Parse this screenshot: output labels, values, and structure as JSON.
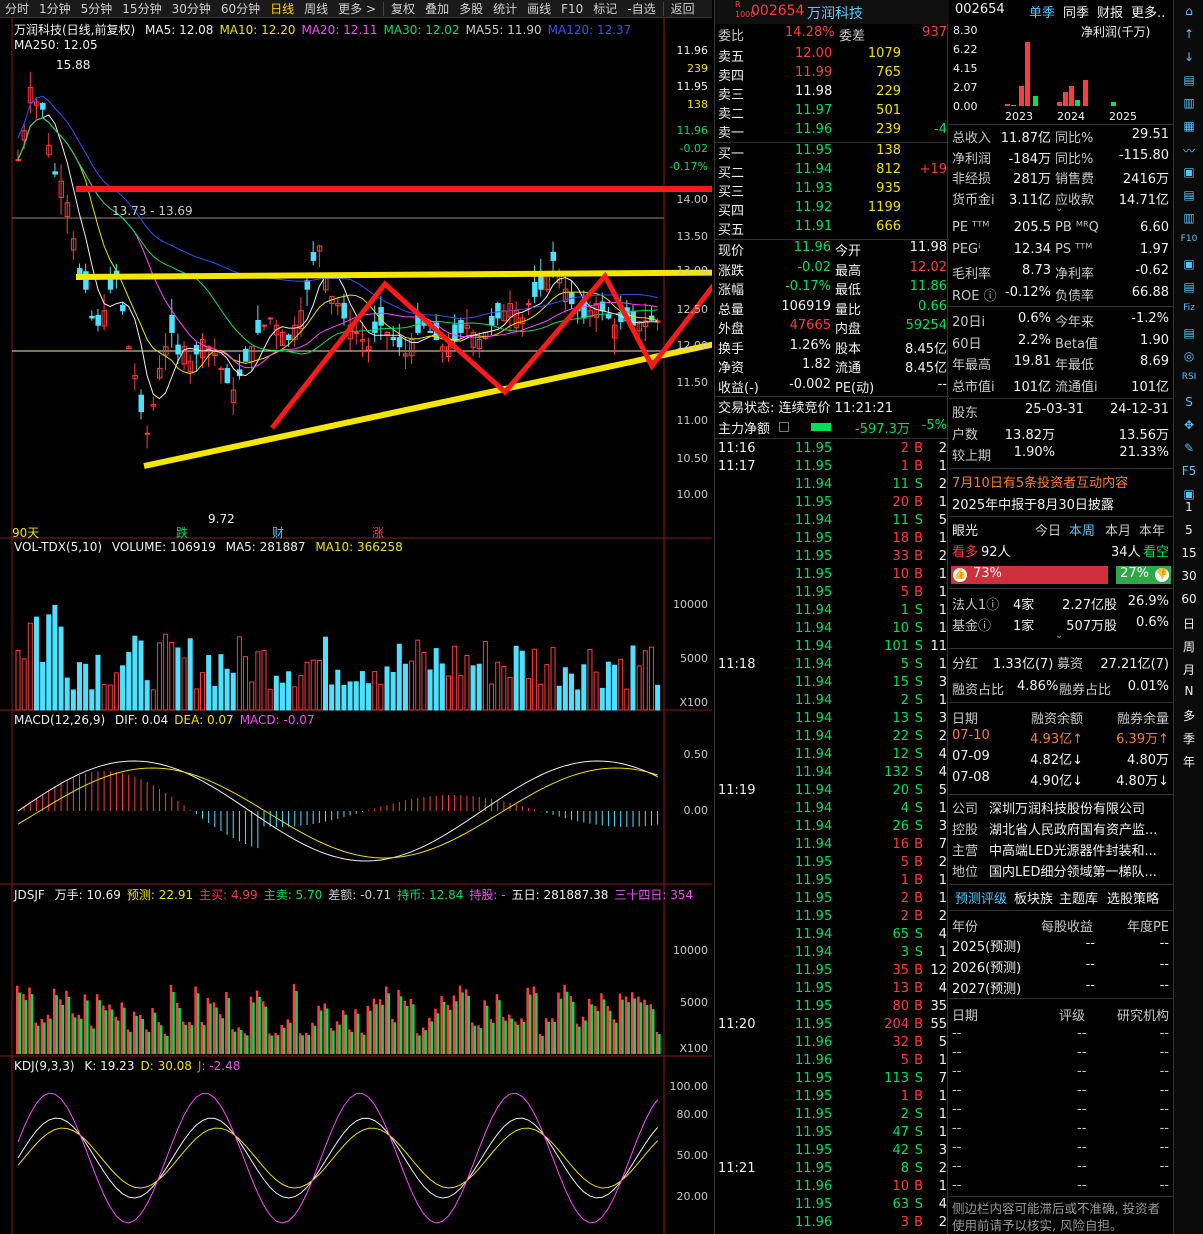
{
  "toolbar": {
    "items": [
      "分时",
      "1分钟",
      "5分钟",
      "15分钟",
      "30分钟",
      "60分钟",
      "日线",
      "周线",
      "更多 >",
      "复权",
      "叠加",
      "多股",
      "统计",
      "画线",
      "F10",
      "标记",
      "-自选",
      "返回"
    ],
    "active": "日线"
  },
  "main_chart": {
    "title": "万润科技(日线,前复权)",
    "ma_labels": [
      {
        "text": "MA5: 12.08",
        "color": "#f0f0f0"
      },
      {
        "text": "MA10: 12.20",
        "color": "#f0e000"
      },
      {
        "text": "MA20: 12.11",
        "color": "#ff44ff"
      },
      {
        "text": "MA30: 12.02",
        "color": "#00e05a"
      },
      {
        "text": "MA55: 11.90",
        "color": "#c8c8c8"
      },
      {
        "text": "MA120: 12.37",
        "color": "#3050ff"
      }
    ],
    "ma250": "MA250: 12.05",
    "high_label": "15.88",
    "low_label": "9.72",
    "range_label": "13.73 - 13.69",
    "period_label": "90天",
    "markers": [
      {
        "text": "跌",
        "color": "#00e05a"
      },
      {
        "text": "财",
        "color": "#4fc7ff"
      },
      {
        "text": "涨",
        "color": "#ff3b3b"
      }
    ],
    "price_axis": [
      "11.96",
      "239",
      "11.95",
      "138",
      "11.96",
      "-0.02",
      "-0.17%",
      "14.00",
      "13.50",
      "13.00",
      "12.50",
      "12.00",
      "11.50",
      "11.00",
      "10.50",
      "10.00"
    ]
  },
  "volume_panel": {
    "title": "VOL-TDX(5,10)",
    "values": [
      "VOLUME: 106919",
      "MA5: 281887",
      "MA10: 366258"
    ],
    "axis": [
      "10000",
      "5000",
      "X100"
    ]
  },
  "macd_panel": {
    "title": "MACD(12,26,9)",
    "values": [
      {
        "text": "DIF: 0.04",
        "color": "#f0f0f0"
      },
      {
        "text": "DEA: 0.07",
        "color": "#f0e000"
      },
      {
        "text": "MACD: -0.07",
        "color": "#ff44ff"
      }
    ],
    "axis": [
      "0.50",
      "0.00"
    ]
  },
  "jdsjf_panel": {
    "title": "JDSJF",
    "values": [
      {
        "text": "万手: 10.69",
        "color": "#f0f0f0"
      },
      {
        "text": "预测: 22.91",
        "color": "#f0e000"
      },
      {
        "text": "主买: 4.99",
        "color": "#ff3b3b"
      },
      {
        "text": "主卖: 5.70",
        "color": "#00e05a"
      },
      {
        "text": "差额: -0.71",
        "color": "#c8c8c8"
      },
      {
        "text": "持币: 12.84",
        "color": "#00e05a"
      },
      {
        "text": "持股: -",
        "color": "#ff44ff"
      },
      {
        "text": "五日: 281887.38",
        "color": "#f0f0f0"
      },
      {
        "text": "三十四日: 354",
        "color": "#ff44ff"
      }
    ],
    "axis": [
      "10000",
      "5000",
      "X100"
    ]
  },
  "kdj_panel": {
    "title": "KDJ(9,3,3)",
    "values": [
      {
        "text": "K: 19.23",
        "color": "#f0f0f0"
      },
      {
        "text": "D: 30.08",
        "color": "#f0e000"
      },
      {
        "text": "J: -2.48",
        "color": "#ff44ff"
      }
    ],
    "axis": [
      "100.00",
      "80.00",
      "50.00",
      "20.00"
    ]
  },
  "quote": {
    "code": "002654",
    "name": "万润科技",
    "weibi_label": "委比",
    "weibi": "14.28%",
    "weicha_label": "委差",
    "weicha": "937",
    "asks": [
      {
        "label": "卖五",
        "price": "12.00",
        "vol": "1079",
        "pc": "#ff3b3b"
      },
      {
        "label": "卖四",
        "price": "11.99",
        "vol": "765",
        "pc": "#ff3b3b"
      },
      {
        "label": "卖三",
        "price": "11.98",
        "vol": "229",
        "pc": "#f0f0f0"
      },
      {
        "label": "卖二",
        "price": "11.97",
        "vol": "501",
        "pc": "#00e05a"
      },
      {
        "label": "卖一",
        "price": "11.96",
        "vol": "239",
        "pc": "#00e05a",
        "chg": "-4"
      }
    ],
    "bids": [
      {
        "label": "买一",
        "price": "11.95",
        "vol": "138",
        "pc": "#00e05a"
      },
      {
        "label": "买二",
        "price": "11.94",
        "vol": "812",
        "pc": "#00e05a",
        "chg": "+19"
      },
      {
        "label": "买三",
        "price": "11.93",
        "vol": "935",
        "pc": "#00e05a"
      },
      {
        "label": "买四",
        "price": "11.92",
        "vol": "1199",
        "pc": "#00e05a"
      },
      {
        "label": "买五",
        "price": "11.91",
        "vol": "666",
        "pc": "#00e05a"
      }
    ],
    "stats": [
      {
        "l1": "现价",
        "v1": "11.96",
        "c1": "#00e05a",
        "l2": "今开",
        "v2": "11.98",
        "c2": "#f0f0f0"
      },
      {
        "l1": "涨跌",
        "v1": "-0.02",
        "c1": "#00e05a",
        "l2": "最高",
        "v2": "12.02",
        "c2": "#ff3b3b"
      },
      {
        "l1": "涨幅",
        "v1": "-0.17%",
        "c1": "#00e05a",
        "l2": "最低",
        "v2": "11.86",
        "c2": "#00e05a"
      },
      {
        "l1": "总量",
        "v1": "106919",
        "c1": "#f0f0f0",
        "l2": "量比",
        "v2": "0.66",
        "c2": "#00e05a"
      },
      {
        "l1": "外盘",
        "v1": "47665",
        "c1": "#ff3b3b",
        "l2": "内盘",
        "v2": "59254",
        "c2": "#00e05a"
      },
      {
        "l1": "换手",
        "v1": "1.26%",
        "c1": "#f0f0f0",
        "l2": "股本",
        "v2": "8.45亿",
        "c2": "#f0f0f0"
      },
      {
        "l1": "净资",
        "v1": "1.82",
        "c1": "#f0f0f0",
        "l2": "流通",
        "v2": "8.45亿",
        "c2": "#f0f0f0"
      },
      {
        "l1": "收益(-)",
        "v1": "-0.002",
        "c1": "#f0f0f0",
        "l2": "PE(动)",
        "v2": "--",
        "c2": "#f0f0f0"
      }
    ],
    "status": "交易状态: 连续竞价 11:21:21",
    "main_flow_label": "主力净额",
    "main_flow": "-597.3万",
    "main_flow_pct": "-5%",
    "ticks": [
      {
        "t": "11:16",
        "p": "11.95",
        "v": "2",
        "d": "B",
        "n": "2"
      },
      {
        "t": "11:17",
        "p": "11.95",
        "v": "1",
        "d": "B",
        "n": "1"
      },
      {
        "t": "",
        "p": "11.94",
        "v": "11",
        "d": "S",
        "n": "2"
      },
      {
        "t": "",
        "p": "11.95",
        "v": "20",
        "d": "B",
        "n": "1"
      },
      {
        "t": "",
        "p": "11.94",
        "v": "11",
        "d": "S",
        "n": "5"
      },
      {
        "t": "",
        "p": "11.95",
        "v": "18",
        "d": "B",
        "n": "1"
      },
      {
        "t": "",
        "p": "11.95",
        "v": "33",
        "d": "B",
        "n": "2"
      },
      {
        "t": "",
        "p": "11.95",
        "v": "10",
        "d": "B",
        "n": "1"
      },
      {
        "t": "",
        "p": "11.95",
        "v": "5",
        "d": "B",
        "n": "1"
      },
      {
        "t": "",
        "p": "11.94",
        "v": "1",
        "d": "S",
        "n": "1"
      },
      {
        "t": "",
        "p": "11.94",
        "v": "10",
        "d": "S",
        "n": "1"
      },
      {
        "t": "",
        "p": "11.94",
        "v": "101",
        "d": "S",
        "n": "11"
      },
      {
        "t": "11:18",
        "p": "11.94",
        "v": "5",
        "d": "S",
        "n": "1"
      },
      {
        "t": "",
        "p": "11.94",
        "v": "15",
        "d": "S",
        "n": "3"
      },
      {
        "t": "",
        "p": "11.94",
        "v": "2",
        "d": "S",
        "n": "1"
      },
      {
        "t": "",
        "p": "11.94",
        "v": "13",
        "d": "S",
        "n": "3"
      },
      {
        "t": "",
        "p": "11.94",
        "v": "22",
        "d": "S",
        "n": "2"
      },
      {
        "t": "",
        "p": "11.94",
        "v": "12",
        "d": "S",
        "n": "4"
      },
      {
        "t": "",
        "p": "11.94",
        "v": "132",
        "d": "S",
        "n": "4"
      },
      {
        "t": "11:19",
        "p": "11.94",
        "v": "20",
        "d": "S",
        "n": "5"
      },
      {
        "t": "",
        "p": "11.94",
        "v": "4",
        "d": "S",
        "n": "1"
      },
      {
        "t": "",
        "p": "11.94",
        "v": "26",
        "d": "S",
        "n": "3"
      },
      {
        "t": "",
        "p": "11.94",
        "v": "16",
        "d": "B",
        "n": "7"
      },
      {
        "t": "",
        "p": "11.95",
        "v": "5",
        "d": "B",
        "n": "2"
      },
      {
        "t": "",
        "p": "11.95",
        "v": "1",
        "d": "B",
        "n": "1"
      },
      {
        "t": "",
        "p": "11.95",
        "v": "2",
        "d": "B",
        "n": "1"
      },
      {
        "t": "",
        "p": "11.95",
        "v": "2",
        "d": "B",
        "n": "2"
      },
      {
        "t": "",
        "p": "11.94",
        "v": "65",
        "d": "S",
        "n": "4"
      },
      {
        "t": "",
        "p": "11.94",
        "v": "3",
        "d": "S",
        "n": "1"
      },
      {
        "t": "",
        "p": "11.95",
        "v": "35",
        "d": "B",
        "n": "12"
      },
      {
        "t": "",
        "p": "11.95",
        "v": "13",
        "d": "B",
        "n": "4"
      },
      {
        "t": "",
        "p": "11.95",
        "v": "80",
        "d": "B",
        "n": "35"
      },
      {
        "t": "11:20",
        "p": "11.95",
        "v": "204",
        "d": "B",
        "n": "55"
      },
      {
        "t": "",
        "p": "11.96",
        "v": "32",
        "d": "B",
        "n": "5"
      },
      {
        "t": "",
        "p": "11.96",
        "v": "5",
        "d": "B",
        "n": "1"
      },
      {
        "t": "",
        "p": "11.95",
        "v": "113",
        "d": "S",
        "n": "7"
      },
      {
        "t": "",
        "p": "11.95",
        "v": "1",
        "d": "B",
        "n": "1"
      },
      {
        "t": "",
        "p": "11.95",
        "v": "2",
        "d": "S",
        "n": "1"
      },
      {
        "t": "",
        "p": "11.95",
        "v": "47",
        "d": "S",
        "n": "1"
      },
      {
        "t": "",
        "p": "11.95",
        "v": "42",
        "d": "S",
        "n": "3"
      },
      {
        "t": "11:21",
        "p": "11.95",
        "v": "8",
        "d": "S",
        "n": "2"
      },
      {
        "t": "",
        "p": "11.96",
        "v": "10",
        "d": "B",
        "n": "1"
      },
      {
        "t": "",
        "p": "11.95",
        "v": "63",
        "d": "S",
        "n": "4"
      },
      {
        "t": "",
        "p": "11.96",
        "v": "3",
        "d": "B",
        "n": "2"
      }
    ]
  },
  "info": {
    "code": "002654",
    "tabs": [
      "单季",
      "同季",
      "财报",
      "更多.."
    ],
    "chart_title": "净利润(千万)",
    "chart_axis": [
      "8.30",
      "6.22",
      "4.15",
      "2.07",
      "0.00"
    ],
    "chart_years": [
      "2023",
      "2024",
      "2025"
    ],
    "fin": [
      {
        "l1": "总收入",
        "v1": "11.87亿",
        "l2": "同比%",
        "v2": "29.51"
      },
      {
        "l1": "净利润",
        "v1": "-184万",
        "l2": "同比%",
        "v2": "-115.80"
      },
      {
        "l1": "非经损",
        "v1": "281万",
        "l2": "销售费",
        "v2": "2416万"
      },
      {
        "l1": "货币金i",
        "v1": "3.11亿",
        "l2": "应收款",
        "v2": "14.71亿"
      }
    ],
    "val": [
      {
        "l1": "PE ᵀᵀᴹ",
        "v1": "205.5",
        "l2": "PB ᴹᴿQ",
        "v2": "6.60"
      },
      {
        "l1": "PEGⁱ",
        "v1": "12.34",
        "l2": "PS ᵀᵀᴹ",
        "v2": "1.97"
      },
      {
        "l1": "毛利率",
        "v1": "8.73",
        "l2": "净利率",
        "v2": "-0.62"
      },
      {
        "l1": "ROE ⓘ",
        "v1": "-0.12%",
        "l2": "负债率",
        "v2": "66.88"
      }
    ],
    "perf": [
      {
        "l1": "20日i",
        "v1": "0.6%",
        "l2": "今年来",
        "v2": "-1.2%"
      },
      {
        "l1": "60日",
        "v1": "2.2%",
        "l2": "Beta值",
        "v2": "1.90"
      },
      {
        "l1": "年最高",
        "v1": "19.81",
        "l2": "年最低",
        "v2": "8.69"
      },
      {
        "l1": "总市值i",
        "v1": "101亿",
        "l2": "流通值i",
        "v2": "101亿"
      }
    ],
    "holders_hdr": {
      "l": "股东",
      "d1": "25-03-31",
      "d2": "24-12-31"
    },
    "holders": [
      {
        "l": "户数",
        "v1": "13.82万",
        "v2": "13.56万"
      },
      {
        "l": "较上期",
        "v1": "1.90%",
        "v2": "21.33%"
      }
    ],
    "notice1": "7月10日有5条投资者互动内容",
    "notice2": "2025年中报于8月30日披露",
    "eye_label": "眼光",
    "eye_tabs": [
      "今日",
      "本周",
      "本月",
      "本年"
    ],
    "bull_label": "看多",
    "bull_count": "92人",
    "bear_count": "34人",
    "bear_label": "看空",
    "bull_pct": "73%",
    "bear_pct": "27%",
    "inst": [
      {
        "l": "法人1ⓘ",
        "n": "4家",
        "v": "2.27亿股",
        "p": "26.9%"
      },
      {
        "l": "基金ⓘ",
        "n": "1家",
        "v": "507万股",
        "p": "0.6%"
      }
    ],
    "fenhong": {
      "l1": "分红",
      "v1": "1.33亿(7)",
      "l2": "募资",
      "v2": "27.21亿(7)"
    },
    "margin": {
      "l1": "融资占比",
      "v1": "4.86%",
      "l2": "融券占比",
      "v2": "0.01%"
    },
    "margin_hdr": [
      "日期",
      "融资余额",
      "融券余量"
    ],
    "margin_rows": [
      {
        "d": "07-10",
        "a": "4.93亿↑",
        "b": "6.39万↑",
        "hl": true
      },
      {
        "d": "07-09",
        "a": "4.82亿↓",
        "b": "4.80万",
        "hl": false
      },
      {
        "d": "07-08",
        "a": "4.90亿↓",
        "b": "4.80万↓",
        "hl": false
      }
    ],
    "company": [
      {
        "l": "公司",
        "v": "深圳万润科技股份有限公司"
      },
      {
        "l": "控股",
        "v": "湖北省人民政府国有资产监..."
      },
      {
        "l": "主营",
        "v": "中高端LED光源器件封装和..."
      },
      {
        "l": "地位",
        "v": "国内LED细分领域第一梯队..."
      }
    ],
    "links": [
      "预测评级",
      "板块族",
      "主题库",
      "选股策略"
    ],
    "forecast_hdr": [
      "年份",
      "每股收益",
      "年度PE"
    ],
    "forecast": [
      {
        "y": "2025(预测)",
        "e": "--",
        "p": "--"
      },
      {
        "y": "2026(预测)",
        "e": "--",
        "p": "--"
      },
      {
        "y": "2027(预测)",
        "e": "--",
        "p": "--"
      }
    ],
    "rating_hdr": [
      "日期",
      "评级",
      "研究机构"
    ],
    "rating_rows": [
      "--",
      "--",
      "--",
      "--",
      "--",
      "--",
      "--",
      "--",
      "--"
    ],
    "footer": "侧边栏内容可能滞后或不准确, 投资者使用前请予以核实, 风险自担。"
  },
  "tools": [
    "⌂",
    "↑",
    "↓",
    "▤",
    "▥",
    "▦",
    "〰",
    "▣",
    "▤",
    "▥",
    "F10",
    "▣",
    "▤",
    "Fiz",
    "▤",
    "◎",
    "RSI",
    "S",
    "✥",
    "✎",
    "F5",
    "▣",
    "1",
    "5",
    "15",
    "30",
    "60",
    "日",
    "周",
    "月",
    "N",
    "多",
    "季",
    "年"
  ]
}
